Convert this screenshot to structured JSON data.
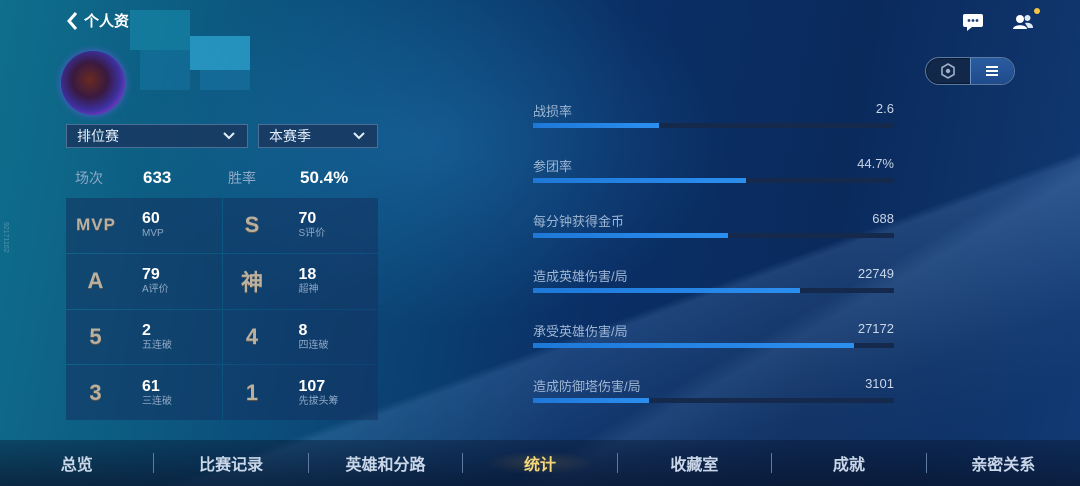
{
  "header": {
    "back_label": "个人资"
  },
  "filters": {
    "mode": "排位赛",
    "season": "本赛季"
  },
  "summary": {
    "matches_label": "场次",
    "matches_value": "633",
    "winrate_label": "胜率",
    "winrate_value": "50.4%"
  },
  "honors": [
    {
      "emblem": "MVP",
      "value": "60",
      "label": "MVP"
    },
    {
      "emblem": "S",
      "value": "70",
      "label": "S评价"
    },
    {
      "emblem": "A",
      "value": "79",
      "label": "A评价"
    },
    {
      "emblem": "神",
      "value": "18",
      "label": "超神"
    },
    {
      "emblem": "5",
      "value": "2",
      "label": "五连破"
    },
    {
      "emblem": "4",
      "value": "8",
      "label": "四连破"
    },
    {
      "emblem": "3",
      "value": "61",
      "label": "三连破"
    },
    {
      "emblem": "1",
      "value": "107",
      "label": "先拔头筹"
    }
  ],
  "stats": [
    {
      "label": "战损率",
      "value": "2.6",
      "progress": 0.35
    },
    {
      "label": "参团率",
      "value": "44.7%",
      "progress": 0.59
    },
    {
      "label": "每分钟获得金币",
      "value": "688",
      "progress": 0.54
    },
    {
      "label": "造成英雄伤害/局",
      "value": "22749",
      "progress": 0.74
    },
    {
      "label": "承受英雄伤害/局",
      "value": "27172",
      "progress": 0.89
    },
    {
      "label": "造成防御塔伤害/局",
      "value": "3101",
      "progress": 0.32
    }
  ],
  "nav": {
    "tabs": [
      {
        "label": "总览"
      },
      {
        "label": "比赛记录"
      },
      {
        "label": "英雄和分路"
      },
      {
        "label": "统计"
      },
      {
        "label": "收藏室"
      },
      {
        "label": "成就"
      },
      {
        "label": "亲密关系"
      }
    ],
    "active_tab": "统计"
  },
  "side_watermark": "92171162",
  "colors": {
    "accent": "#2b8ff0",
    "active_tab": "#f4d77a",
    "notify_dot": "#f4c542"
  },
  "icons": {
    "back": "chevron-left-icon",
    "chat": "chat-bubble-icon",
    "friends": "friends-icon",
    "view_honor": "hexagon-icon",
    "view_list": "list-icon"
  }
}
